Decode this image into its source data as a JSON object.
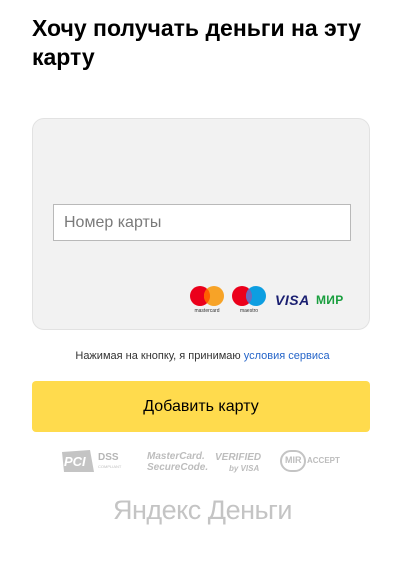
{
  "title": "Хочу получать деньги на эту карту",
  "card_form": {
    "card_number_placeholder": "Номер карты",
    "card_number_value": ""
  },
  "payment_logos": {
    "mastercard_label": "mastercard",
    "maestro_label": "maestro",
    "visa_label": "VISA",
    "mir_label": "МИР"
  },
  "terms": {
    "text": "Нажимая на кнопку, я принимаю ",
    "link": "условия сервиса"
  },
  "add_button_label": "Добавить карту",
  "security_badges": {
    "pci_pci": "PCI",
    "pci_dss": "DSS",
    "pci_compliant": "COMPLIANT",
    "mastercard_securecode_line1": "MasterCard.",
    "mastercard_securecode_line2": "SecureCode.",
    "verified_line1": "VERIFIED",
    "verified_line2": "by VISA",
    "mir_accept_mir": "MIR",
    "mir_accept_accept": "ACCEPT"
  },
  "footer_brand": "Яндекс Деньги",
  "colors": {
    "button": "#ffdb4d",
    "link": "#2565c9",
    "mastercard_red": "#eb001b",
    "mastercard_orange": "#f79e1b",
    "maestro_blue": "#0099df",
    "visa_blue": "#1a1f71",
    "mir_green": "#1a9f3f"
  }
}
